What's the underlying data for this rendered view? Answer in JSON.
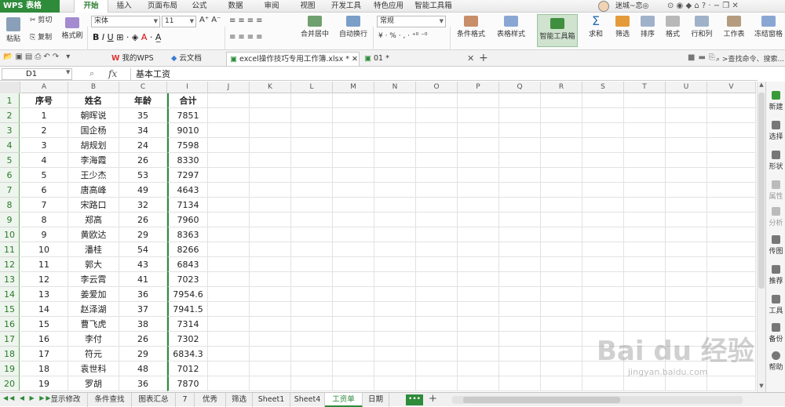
{
  "app": {
    "logo": "WPS 表格",
    "user": "迷城~恋◎"
  },
  "menu": [
    "开始",
    "插入",
    "页面布局",
    "公式",
    "数据",
    "审阅",
    "视图",
    "开发工具",
    "特色应用",
    "智能工具箱"
  ],
  "ribbon": {
    "paste": "粘贴",
    "cut": "剪切",
    "copy": "复制",
    "format_painter": "格式刷",
    "font": "宋体",
    "size": "11",
    "merge": "合并居中",
    "wrap": "自动换行",
    "numformat": "常规",
    "cond_format": "条件格式",
    "table_style": "表格样式",
    "smart_toolbox": "智能工具箱",
    "sum": "求和",
    "filter": "筛选",
    "sort": "排序",
    "format": "格式",
    "rows_cols": "行和列",
    "worksheet": "工作表",
    "freeze": "冻结窗格"
  },
  "tabs": {
    "my_wps": "我的WPS",
    "cloud": "云文档",
    "doc1": "excel操作技巧专用工作簿.xlsx *",
    "doc2": "01 *",
    "search": "查找命令、搜索..."
  },
  "formula": {
    "cell": "D1",
    "fx": "fx",
    "value": "基本工资"
  },
  "columns": [
    "A",
    "B",
    "C",
    "I",
    "J",
    "K",
    "L",
    "M",
    "N",
    "O",
    "P",
    "Q",
    "R",
    "S",
    "T",
    "U",
    "V"
  ],
  "rows": [
    "1",
    "2",
    "3",
    "4",
    "5",
    "6",
    "7",
    "8",
    "9",
    "10",
    "11",
    "12",
    "13",
    "14",
    "15",
    "16",
    "17",
    "18",
    "19",
    "20"
  ],
  "table": {
    "headers": [
      "序号",
      "姓名",
      "年龄",
      "合计"
    ],
    "data": [
      [
        "1",
        "朝晖说",
        "35",
        "7851"
      ],
      [
        "2",
        "国企杨",
        "34",
        "9010"
      ],
      [
        "3",
        "胡规划",
        "24",
        "7598"
      ],
      [
        "4",
        "李海霞",
        "26",
        "8330"
      ],
      [
        "5",
        "王少杰",
        "53",
        "7297"
      ],
      [
        "6",
        "唐高峰",
        "49",
        "4643"
      ],
      [
        "7",
        "宋路口",
        "32",
        "7134"
      ],
      [
        "8",
        "郑高",
        "26",
        "7960"
      ],
      [
        "9",
        "黄欧达",
        "29",
        "8363"
      ],
      [
        "10",
        "潘桂",
        "54",
        "8266"
      ],
      [
        "11",
        "郭大",
        "43",
        "6843"
      ],
      [
        "12",
        "李云霄",
        "41",
        "7023"
      ],
      [
        "13",
        "姜爱加",
        "36",
        "7954.6"
      ],
      [
        "14",
        "赵泽湖",
        "37",
        "7941.5"
      ],
      [
        "15",
        "曹飞虎",
        "38",
        "7314"
      ],
      [
        "16",
        "李付",
        "26",
        "7302"
      ],
      [
        "17",
        "符元",
        "29",
        "6834.3"
      ],
      [
        "18",
        "袁世科",
        "48",
        "7012"
      ],
      [
        "19",
        "罗胡",
        "36",
        "7870"
      ]
    ]
  },
  "right_panel": [
    "新建",
    "选择",
    "形状",
    "属性",
    "分析",
    "传图",
    "推荐",
    "工具",
    "备份",
    "帮助"
  ],
  "sheets": [
    "显示修改",
    "条件查找",
    "图表汇总",
    "7",
    "优秀",
    "筛选",
    "Sheet1",
    "Sheet4",
    "工资单",
    "日期"
  ],
  "active_sheet": "工资单",
  "watermark": {
    "main": "Bai du 经验",
    "sub": "jingyan.baidu.com"
  },
  "colors": {
    "accent": "#2e8b3a"
  }
}
